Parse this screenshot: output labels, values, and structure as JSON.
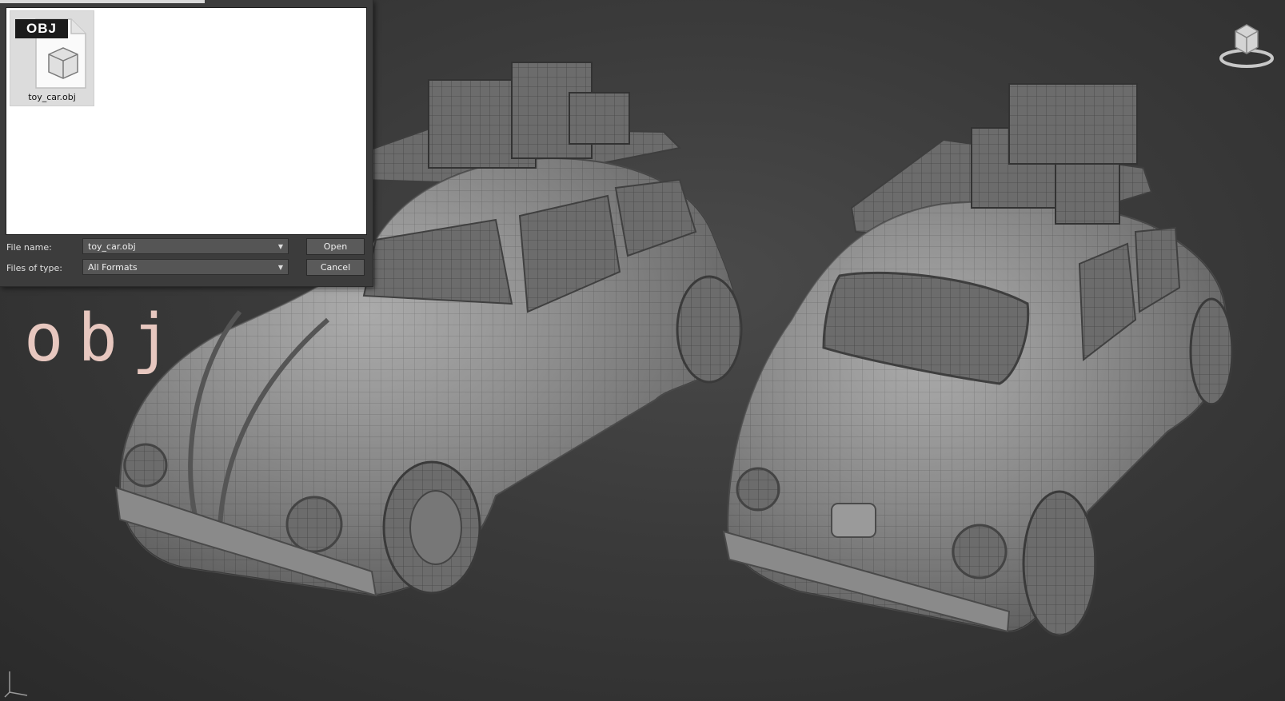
{
  "dialog": {
    "file_item": {
      "badge": "OBJ",
      "name": "toy_car.obj",
      "icon": "obj-file-icon"
    },
    "file_name_label": "File name:",
    "file_name_value": "toy_car.obj",
    "files_of_type_label": "Files of type:",
    "files_of_type_value": "All Formats",
    "open_label": "Open",
    "cancel_label": "Cancel"
  },
  "overlay": {
    "format_text": "obj"
  },
  "viewport": {
    "objects": [
      {
        "type": "beetle-car-wireframe"
      },
      {
        "type": "beetle-car-wireframe"
      }
    ],
    "viewcube_icon": "viewcube-icon",
    "axis_icon": "axis-tripod-icon"
  },
  "colors": {
    "background": "#3a3a3a",
    "dialog": "#3c3c3c",
    "overlay_text": "#e7c7bf"
  }
}
